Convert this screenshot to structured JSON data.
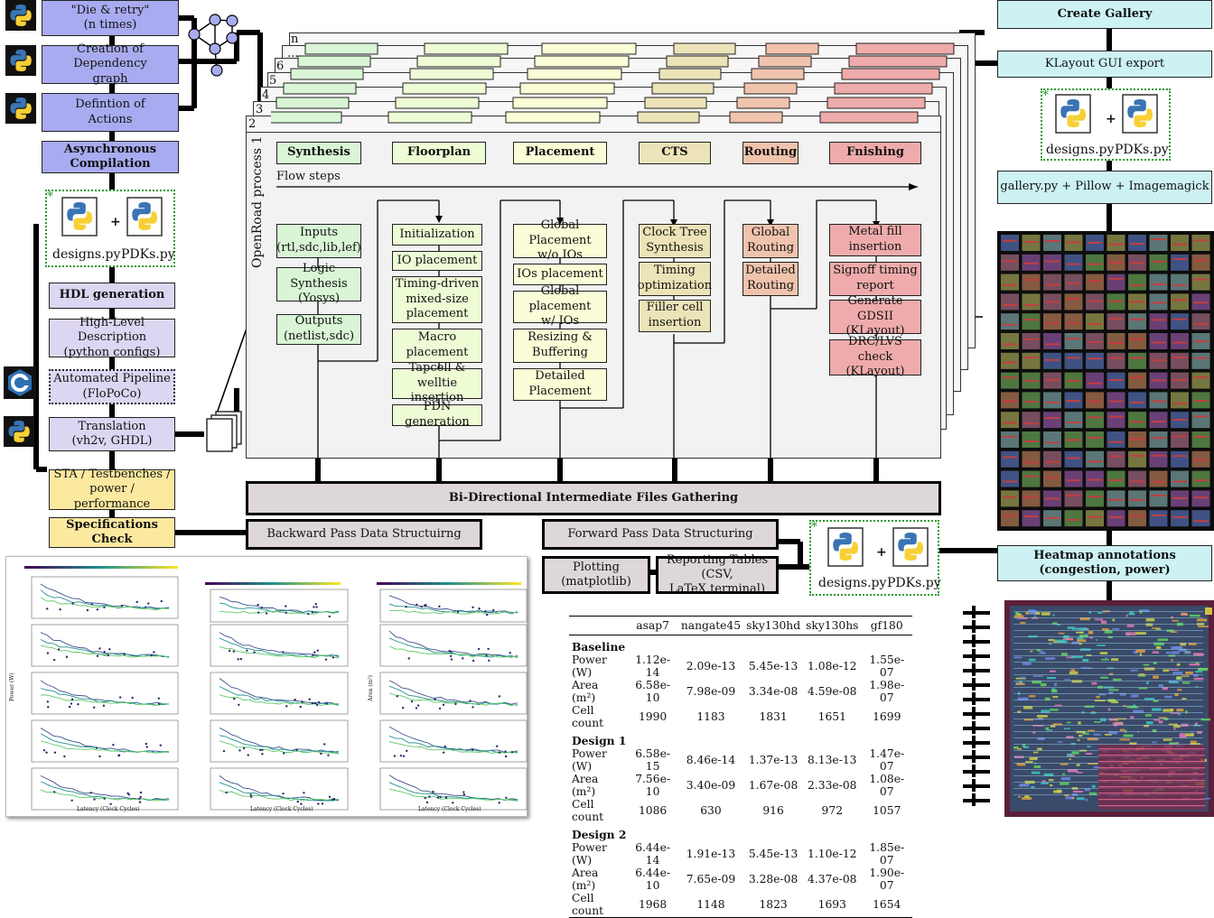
{
  "left_column": {
    "die_retry": "\"Die & retry\"\n(n times)",
    "dependency_graph": "Creation of Dependency\ngraph",
    "definition_actions": "Defintion of\nActions",
    "async_compilation": "Asynchronous\nCompilation",
    "hdl_generation": "HDL generation",
    "high_level_desc": "High-Level Description\n(python configs)",
    "automated_pipeline": "Automated Pipeline\n(FloPoCo)",
    "translation": "Translation\n(vh2v, GHDL)",
    "sta": "STA / Testbenches /\npower / performance",
    "spec_check": "Specifications Check"
  },
  "python_files": {
    "designs": "designs.py",
    "pdks": "PDKs.py",
    "plus": "+",
    "star": "*"
  },
  "openroad": {
    "label": "OpenRoad process 1",
    "stack_numbers": [
      "2",
      "3",
      "4",
      "5",
      "6",
      "...",
      "n"
    ],
    "flow_steps_label": "Flow steps",
    "steps": [
      "Synthesis",
      "Floorplan",
      "Placement",
      "CTS",
      "Routing",
      "Fnishing"
    ],
    "col1": [
      "Inputs\n(rtl,sdc,lib,lef)",
      "Logic Synthesis\n(Yosys)",
      "Outputs\n(netlist,sdc)"
    ],
    "col2": [
      "Initialization",
      "IO placement",
      "Timing-driven\nmixed-size\nplacement",
      "Macro\nplacement",
      "Tapcell & welltie\ninsertion",
      "PDN generation"
    ],
    "col3": [
      "Global Placement\nw/o IOs",
      "IOs placement",
      "Global placement\nw/ IOs",
      "Resizing &\nBuffering",
      "Detailed\nPlacement"
    ],
    "col4": [
      "Clock Tree\nSynthesis",
      "Timing\noptimization",
      "Filler cell\ninsertion"
    ],
    "col5": [
      "Global\nRouting",
      "Detailed\nRouting"
    ],
    "col6": [
      "Metal fill\ninsertion",
      "Signoff timing\nreport",
      "Generate GDSII\n(KLayout)",
      "DRC/LVS check\n(KLayout)"
    ]
  },
  "middle": {
    "gathering": "Bi-Directional Intermediate Files Gathering",
    "backward": "Backward Pass Data Structuirng",
    "forward": "Forward  Pass Data Structuring",
    "plotting": "Plotting\n(matplotlib)",
    "reporting": "Reporting Tables\n(CSV, LaTeX,terminal)"
  },
  "right_column": {
    "create_gallery": "Create  Gallery",
    "klayout_export": "KLayout GUI export",
    "gallery_tools": "gallery.py  +  Pillow + Imagemagick",
    "heatmap": "Heatmap annotations\n(congestion, power)"
  },
  "results_table": {
    "columns": [
      "",
      "asap7",
      "nangate45",
      "sky130hd",
      "sky130hs",
      "gf180"
    ],
    "sections": [
      {
        "name": "Baseline",
        "rows": [
          [
            "Power (W)",
            "1.12e-14",
            "2.09e-13",
            "5.45e-13",
            "1.08e-12",
            "1.55e-07"
          ],
          [
            "Area (m²)",
            "6.58e-10",
            "7.98e-09",
            "3.34e-08",
            "4.59e-08",
            "1.98e-07"
          ],
          [
            "Cell count",
            "1990",
            "1183",
            "1831",
            "1651",
            "1699"
          ]
        ]
      },
      {
        "name": "Design 1",
        "rows": [
          [
            "Power (W)",
            "6.58e-15",
            "8.46e-14",
            "1.37e-13",
            "8.13e-13",
            "1.47e-07"
          ],
          [
            "Area (m²)",
            "7.56e-10",
            "3.40e-09",
            "1.67e-08",
            "2.33e-08",
            "1.08e-07"
          ],
          [
            "Cell count",
            "1086",
            "630",
            "916",
            "972",
            "1057"
          ]
        ]
      },
      {
        "name": "Design 2",
        "rows": [
          [
            "Power (W)",
            "6.44e-14",
            "1.91e-13",
            "5.45e-13",
            "1.10e-12",
            "1.85e-07"
          ],
          [
            "Area (m²)",
            "6.44e-10",
            "7.65e-09",
            "3.28e-08",
            "4.37e-08",
            "1.90e-07"
          ],
          [
            "Cell count",
            "1968",
            "1148",
            "1823",
            "1693",
            "1654"
          ]
        ]
      }
    ]
  },
  "plot_thumbnail": {
    "xlabel": "Latency (Clock Cycles)",
    "ylabels": [
      "Power (W)",
      "Area (m²)"
    ]
  },
  "colors": {
    "lavender": "#a9abf0",
    "light_lavender": "#dcd6f2",
    "yellow": "#fbe9a0",
    "cyan": "#cdf2f3",
    "grey": "#ddd7da",
    "synthesis": "#d9f5d6",
    "floorplan": "#eefcd6",
    "placement": "#fbfdd7",
    "cts": "#ece3b8",
    "routing": "#f0c3ad",
    "finishing": "#efabab"
  }
}
